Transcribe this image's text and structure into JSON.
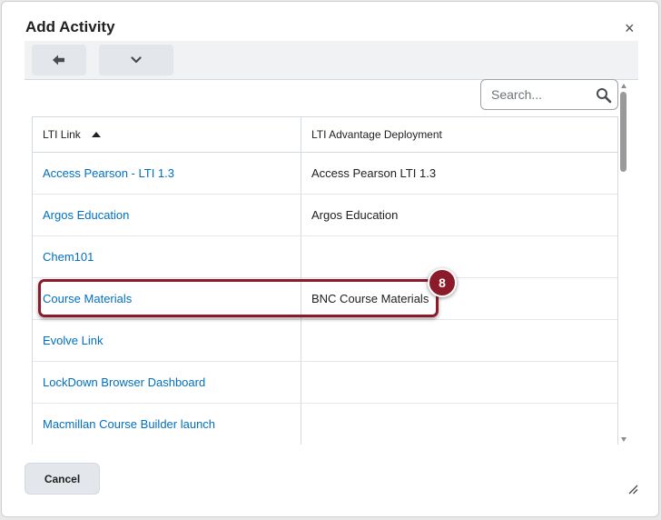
{
  "dialog": {
    "title": "Add Activity",
    "close_label": "×"
  },
  "toolbar": {
    "back_icon": "back-arrow-icon",
    "dropdown_icon": "chevron-down-icon"
  },
  "search": {
    "placeholder": "Search...",
    "icon": "search-icon"
  },
  "table": {
    "columns": [
      {
        "label": "LTI Link",
        "sort": "ascending"
      },
      {
        "label": "LTI Advantage Deployment"
      }
    ],
    "rows": [
      {
        "link": "Access Pearson - LTI 1.3",
        "deployment": "Access Pearson LTI 1.3"
      },
      {
        "link": "Argos Education",
        "deployment": "Argos Education"
      },
      {
        "link": "Chem101",
        "deployment": ""
      },
      {
        "link": "Course Materials",
        "deployment": "BNC Course Materials"
      },
      {
        "link": "Evolve Link",
        "deployment": ""
      },
      {
        "link": "LockDown Browser Dashboard",
        "deployment": ""
      },
      {
        "link": "Macmillan Course Builder launch",
        "deployment": ""
      },
      {
        "link": "",
        "deployment": ""
      }
    ]
  },
  "annotation": {
    "step_number": "8",
    "color": "#8b1a2b"
  },
  "footer": {
    "cancel_label": "Cancel"
  }
}
